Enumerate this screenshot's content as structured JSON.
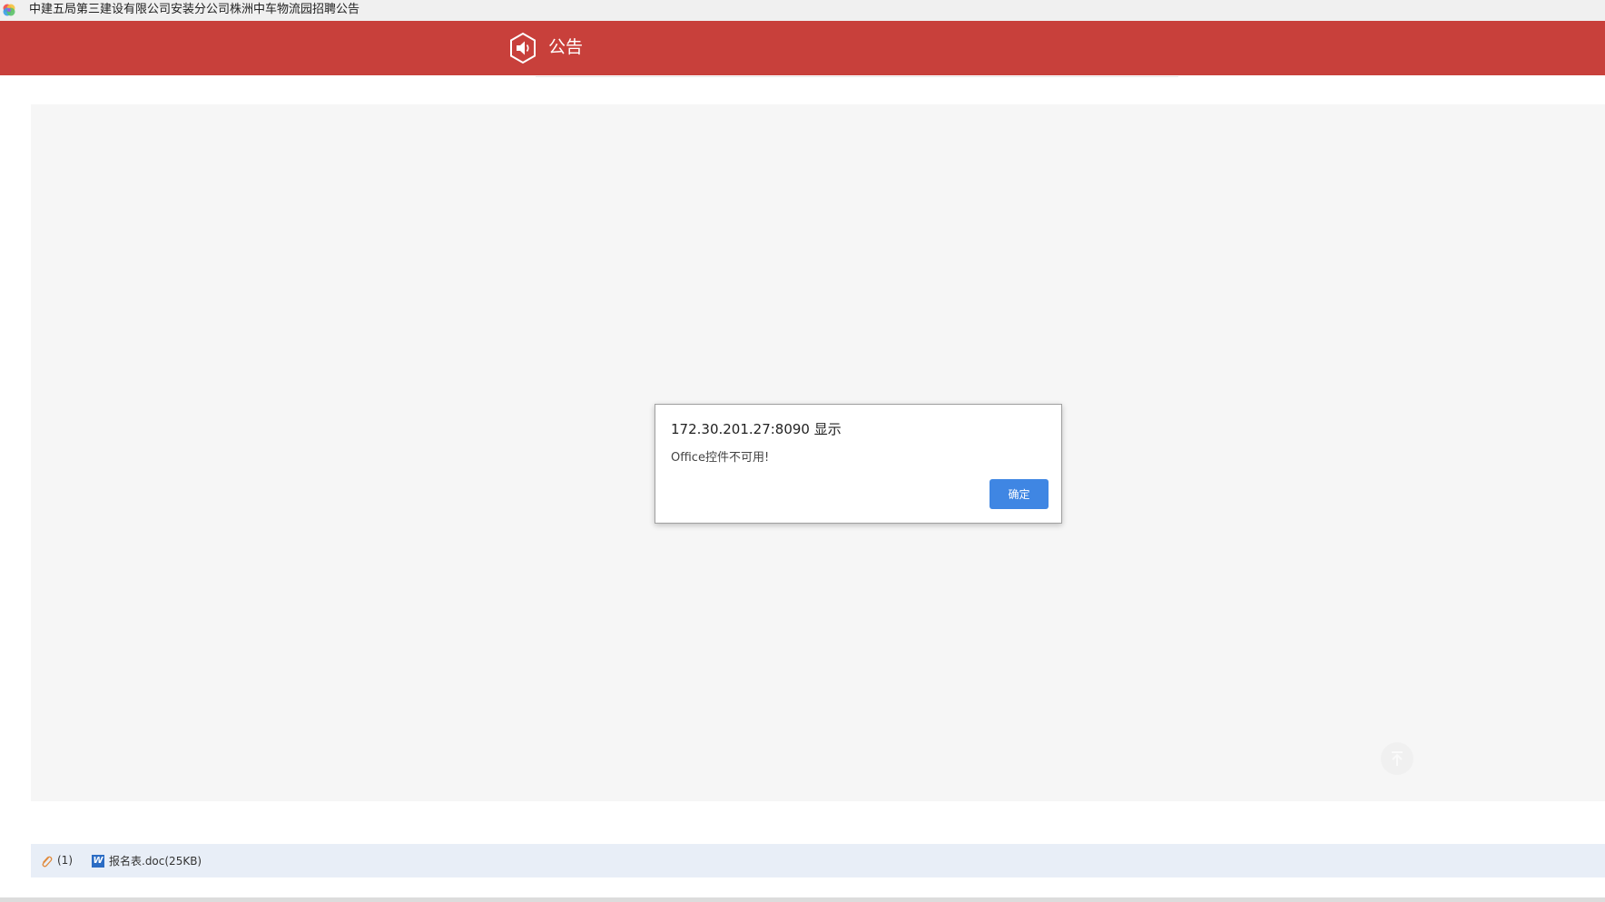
{
  "window": {
    "title": "中建五局第三建设有限公司安装分公司株洲中车物流园招聘公告",
    "app_icon": "colorful-pinwheel-icon"
  },
  "header": {
    "icon": "speaker-hexagon-icon",
    "title": "公告",
    "background_color": "#c8403b"
  },
  "dialog": {
    "title": "172.30.201.27:8090 显示",
    "message": "Office控件不可用!",
    "ok_label": "确定",
    "button_color": "#3f86e3"
  },
  "attachments": {
    "icon": "paperclip-icon",
    "count_label": "(1)",
    "files": [
      {
        "icon": "word-doc-icon",
        "name": "报名表.doc(25KB)"
      }
    ]
  },
  "scroll": {
    "back_to_top_icon": "arrow-up-icon"
  }
}
